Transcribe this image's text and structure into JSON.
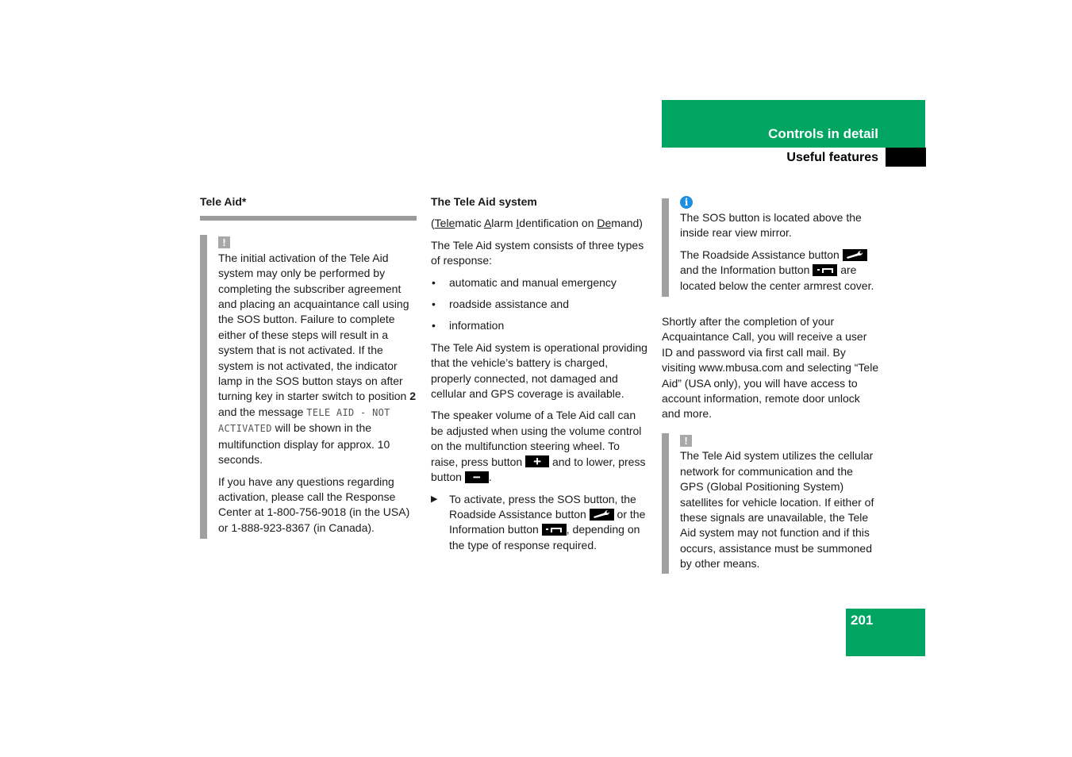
{
  "header": {
    "title": "Controls in detail",
    "subtitle": "Useful features"
  },
  "page_number": "201",
  "colors": {
    "brand_green": "#00a562",
    "note_bar_gray": "#a0a0a0",
    "info_blue": "#1e8fe0"
  },
  "column1": {
    "title": "Tele Aid*",
    "warning_icon": "!",
    "warning_para1_before_bold": "The initial activation of the Tele Aid system may only be performed by completing the subscriber agreement and placing an acquaintance call using the SOS button. Failure to complete either of these steps will result in a system that is not activated. If the system is not activated, the indicator lamp in the SOS button stays on after turning key in starter switch to position ",
    "warning_para1_bold": "2",
    "warning_para1_mid": " and the message ",
    "warning_para1_display": "TELE AID - NOT ACTIVATED",
    "warning_para1_after": " will be shown in the multifunction display for approx. 10 seconds.",
    "warning_para2": "If you have any questions regarding activation, please call the Response Center at 1-800-756-9018 (in the USA) or 1-888-923-8367 (in Canada)."
  },
  "column2": {
    "title": "The Tele Aid system",
    "acronym": {
      "open": "(",
      "w1_u": "Tele",
      "w1_rest": "matic ",
      "w2_u": "A",
      "w2_rest": "larm ",
      "w3_u": "I",
      "w3_rest": "dentification on ",
      "w4_u": "De",
      "w4_rest": "mand)"
    },
    "intro": "The Tele Aid system consists of three types of response:",
    "bullets": [
      "automatic and manual emergency",
      "roadside assistance and",
      "information"
    ],
    "operational": "The Tele Aid system is operational providing that the vehicle’s battery is charged, properly connected, not damaged and cellular and GPS coverage is available.",
    "volume_before_plus": "The speaker volume of a Tele Aid call can be adjusted when using the volume control on the multifunction steering wheel. To raise, press button ",
    "plus_label": "+",
    "volume_mid": " and to lower, press button ",
    "minus_label": "−",
    "volume_end": ".",
    "step_marker": "▶",
    "step_part1": "To activate, press the SOS button, the Roadside Assistance button ",
    "step_part2": " or the Information button ",
    "step_part3": ", depending on the type of response required."
  },
  "column3": {
    "info_icon": "i",
    "info_para1": "The SOS button is located above the inside rear view mirror.",
    "info_para2_a": "The Roadside Assistance button ",
    "info_para2_b": " and the Information button ",
    "info_para2_c": " are located below the center armrest cover.",
    "body": "Shortly after the completion of your Acquaintance Call, you will receive a user ID and password via first call mail. By visiting www.mbusa.com and selecting “Tele Aid” (USA only), you will have access to account information, remote door unlock and more.",
    "warning_icon": "!",
    "warning_text": "The Tele Aid system utilizes the cellular network for communication and the GPS (Global Positioning System) satellites for vehicle location. If either of these signals are unavailable, the Tele Aid system may not function and if this occurs, assistance must be summoned by other means."
  },
  "icons": {
    "roadside": "wrench-icon",
    "information": "information-button-icon"
  }
}
